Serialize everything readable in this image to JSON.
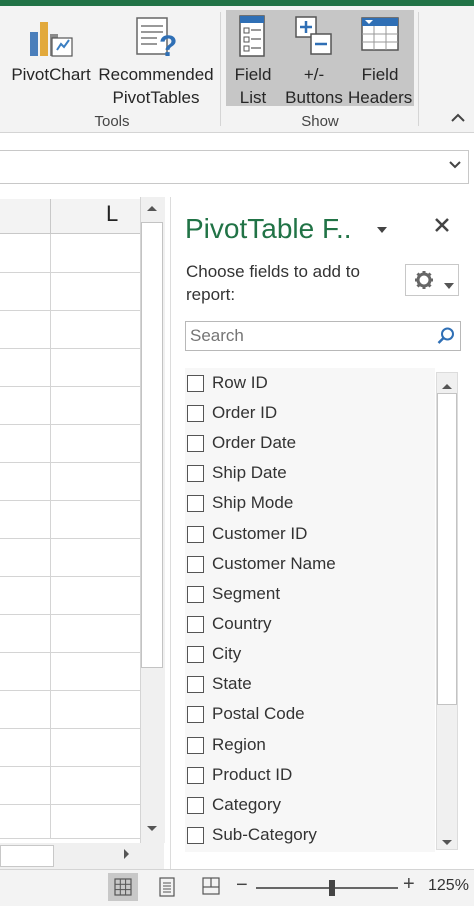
{
  "ribbon": {
    "pivotchart_label": "PivotChart",
    "recommended_line1": "Recommended",
    "recommended_line2": "PivotTables",
    "tools_group": "Tools",
    "field_list_line1": "Field",
    "field_list_line2": "List",
    "buttons_line1": "+/-",
    "buttons_line2": "Buttons",
    "field_headers_line1": "Field",
    "field_headers_line2": "Headers",
    "show_group": "Show",
    "accent_color": "#217346",
    "highlight_color": "#c6c6c6"
  },
  "grid": {
    "column_label": "L"
  },
  "pivot_pane": {
    "title": "PivotTable F..",
    "choose_text": "Choose fields to add to report:",
    "search_placeholder": "Search",
    "fields": [
      {
        "label": "Row ID",
        "checked": false
      },
      {
        "label": "Order ID",
        "checked": false
      },
      {
        "label": "Order Date",
        "checked": false
      },
      {
        "label": "Ship Date",
        "checked": false
      },
      {
        "label": "Ship Mode",
        "checked": false
      },
      {
        "label": "Customer ID",
        "checked": false
      },
      {
        "label": "Customer Name",
        "checked": false
      },
      {
        "label": "Segment",
        "checked": false
      },
      {
        "label": "Country",
        "checked": false
      },
      {
        "label": "City",
        "checked": false
      },
      {
        "label": "State",
        "checked": false
      },
      {
        "label": "Postal Code",
        "checked": false
      },
      {
        "label": "Region",
        "checked": false
      },
      {
        "label": "Product ID",
        "checked": false
      },
      {
        "label": "Category",
        "checked": false
      },
      {
        "label": "Sub-Category",
        "checked": false
      }
    ]
  },
  "status": {
    "zoom_level": "125%",
    "zoom_value": 125
  }
}
